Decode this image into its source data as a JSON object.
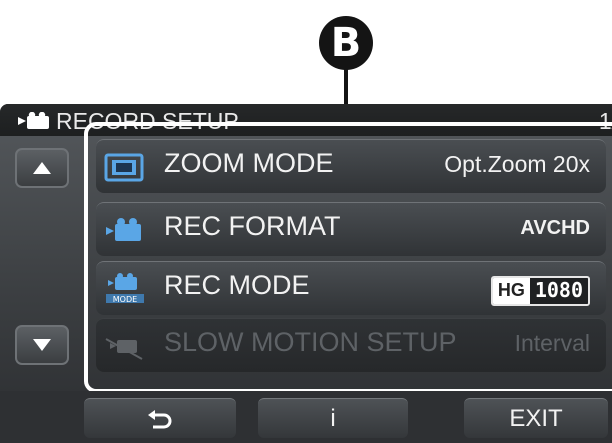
{
  "callout": {
    "label": "B"
  },
  "header": {
    "title": "RECORD SETUP",
    "page": "1/"
  },
  "scroll": {
    "up_icon": "triangle-up",
    "down_icon": "triangle-down"
  },
  "menu_items": [
    {
      "icon": "zoom-mode-icon",
      "label": "ZOOM MODE",
      "value": "Opt.Zoom 20x",
      "enabled": true
    },
    {
      "icon": "rec-format-icon",
      "label": "REC FORMAT",
      "value": "AVCHD",
      "enabled": true
    },
    {
      "icon": "rec-mode-icon",
      "label": "REC MODE",
      "value_badge": {
        "quality": "HG",
        "resolution": "1080"
      },
      "enabled": true
    },
    {
      "icon": "slow-motion-icon",
      "label": "SLOW MOTION SETUP",
      "value": "Interval",
      "enabled": false
    }
  ],
  "bottom_bar": {
    "back_icon": "return-arrow",
    "info_label": "i",
    "exit_label": "EXIT"
  },
  "colors": {
    "screen_bg": "#3c3f42",
    "frame": "#ffffff",
    "icon_blue": "#5aa6e6",
    "disabled_text": "#5e6266"
  }
}
